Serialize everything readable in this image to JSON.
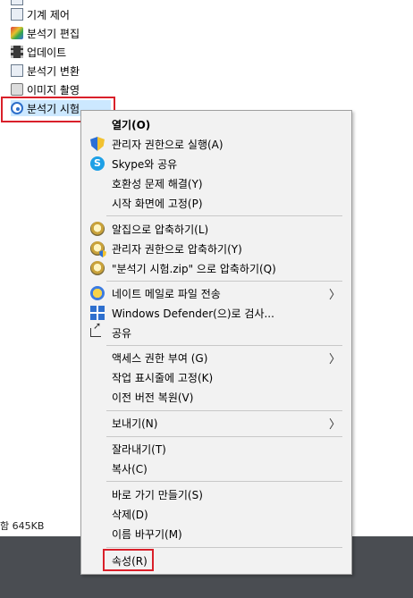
{
  "file_list": [
    {
      "label": "기계 제어",
      "icon": "sheet-icon",
      "name": "file-item-machine-control"
    },
    {
      "label": "분석기 편집",
      "icon": "color-app-icon",
      "name": "file-item-analyzer-edit"
    },
    {
      "label": "업데이트",
      "icon": "film-icon",
      "name": "file-item-update"
    },
    {
      "label": "분석기 변환",
      "icon": "sheet-icon",
      "name": "file-item-analyzer-convert"
    },
    {
      "label": "이미지 촬영",
      "icon": "camera-icon",
      "name": "file-item-image-capture"
    },
    {
      "label": "분석기 시험",
      "icon": "disc-icon",
      "name": "file-item-analyzer-test"
    }
  ],
  "status_text": "함 645KB",
  "context_menu": {
    "open": "열기(O)",
    "run_as_admin": "관리자 권한으로 실행(A)",
    "skype_share": "Skype와 공유",
    "compat_troubleshoot": "호환성 문제 해결(Y)",
    "pin_start": "시작 화면에 고정(P)",
    "zip_alzip": "알집으로 압축하기(L)",
    "zip_admin": "관리자 권한으로 압축하기(Y)",
    "zip_named": "\"분석기 시험.zip\" 으로 압축하기(Q)",
    "nate_send": "네이트 메일로 파일 전송",
    "defender_scan": "Windows Defender(으)로 검사...",
    "share": "공유",
    "give_access": "액세스 권한 부여 (G)",
    "pin_taskbar": "작업 표시줄에 고정(K)",
    "restore_prev": "이전 버전 복원(V)",
    "send_to": "보내기(N)",
    "cut": "잘라내기(T)",
    "copy": "복사(C)",
    "create_shortcut": "바로 가기 만들기(S)",
    "delete": "삭제(D)",
    "rename": "이름 바꾸기(M)",
    "properties": "속성(R)",
    "submenu_arrow": "〉"
  },
  "colors": {
    "highlight_red": "#d9202a",
    "taskbar": "#4a4d52",
    "menu_bg": "#f2f2f2"
  }
}
